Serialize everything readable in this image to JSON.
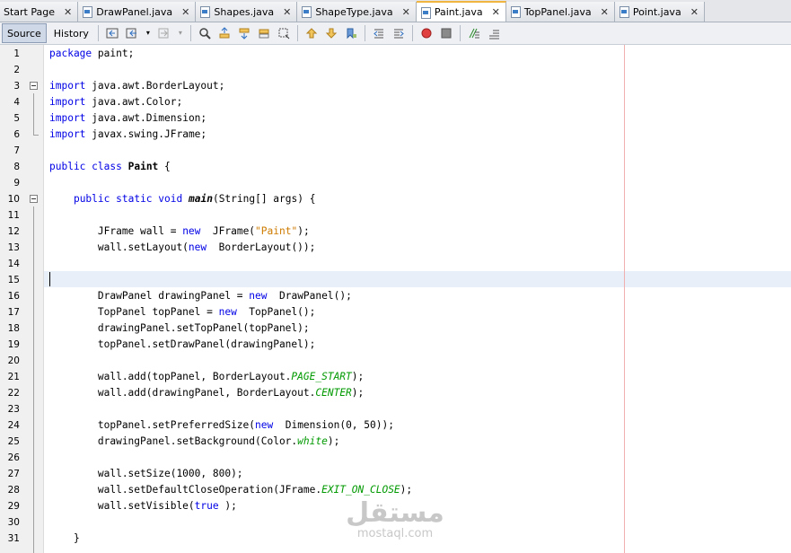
{
  "tabs": [
    {
      "label": "Start Page",
      "active": false,
      "icon": "none"
    },
    {
      "label": "DrawPanel.java",
      "active": false,
      "icon": "java-file-icon"
    },
    {
      "label": "Shapes.java",
      "active": false,
      "icon": "java-file-icon"
    },
    {
      "label": "ShapeType.java",
      "active": false,
      "icon": "java-file-icon"
    },
    {
      "label": "Paint.java",
      "active": true,
      "icon": "java-file-icon"
    },
    {
      "label": "TopPanel.java",
      "active": false,
      "icon": "java-file-icon"
    },
    {
      "label": "Point.java",
      "active": false,
      "icon": "java-file-icon"
    }
  ],
  "close_glyph": "✕",
  "toolbar": {
    "source_label": "Source",
    "history_label": "History"
  },
  "lines": [
    {
      "n": "1",
      "tokens": [
        [
          "kw",
          "package"
        ],
        [
          "",
          "paint;"
        ]
      ]
    },
    {
      "n": "2",
      "tokens": []
    },
    {
      "n": "3",
      "tokens": [
        [
          "kw",
          "import"
        ],
        [
          "",
          "java.awt.BorderLayout;"
        ]
      ]
    },
    {
      "n": "4",
      "tokens": [
        [
          "kw",
          "import"
        ],
        [
          "",
          "java.awt.Color;"
        ]
      ]
    },
    {
      "n": "5",
      "tokens": [
        [
          "kw",
          "import"
        ],
        [
          "",
          "java.awt.Dimension;"
        ]
      ]
    },
    {
      "n": "6",
      "tokens": [
        [
          "kw",
          "import"
        ],
        [
          "",
          "javax.swing.JFrame;"
        ]
      ]
    },
    {
      "n": "7",
      "tokens": []
    },
    {
      "n": "8",
      "tokens": [
        [
          "kw",
          "public"
        ],
        [
          "",
          ""
        ],
        [
          "kw",
          "class"
        ],
        [
          "",
          ""
        ],
        [
          "bold",
          "Paint"
        ],
        [
          "",
          " {"
        ]
      ]
    },
    {
      "n": "9",
      "tokens": []
    },
    {
      "n": "10",
      "tokens": [
        [
          "",
          "    "
        ],
        [
          "kw",
          "public"
        ],
        [
          "",
          ""
        ],
        [
          "kw",
          "static"
        ],
        [
          "",
          ""
        ],
        [
          "kw",
          "void"
        ],
        [
          "",
          ""
        ],
        [
          "bolditalic",
          "main"
        ],
        [
          "",
          "(String[] args) {"
        ]
      ]
    },
    {
      "n": "11",
      "tokens": []
    },
    {
      "n": "12",
      "tokens": [
        [
          "",
          "        JFrame wall = "
        ],
        [
          "kw",
          "new"
        ],
        [
          "",
          " JFrame("
        ],
        [
          "str",
          "\"Paint\""
        ],
        [
          "",
          ");"
        ]
      ]
    },
    {
      "n": "13",
      "tokens": [
        [
          "",
          "        wall.setLayout("
        ],
        [
          "kw",
          "new"
        ],
        [
          "",
          " BorderLayout());"
        ]
      ]
    },
    {
      "n": "14",
      "tokens": []
    },
    {
      "n": "15",
      "tokens": []
    },
    {
      "n": "16",
      "tokens": [
        [
          "",
          "        DrawPanel drawingPanel = "
        ],
        [
          "kw",
          "new"
        ],
        [
          "",
          " DrawPanel();"
        ]
      ]
    },
    {
      "n": "17",
      "tokens": [
        [
          "",
          "        TopPanel topPanel = "
        ],
        [
          "kw",
          "new"
        ],
        [
          "",
          " TopPanel();"
        ]
      ]
    },
    {
      "n": "18",
      "tokens": [
        [
          "",
          "        drawingPanel.setTopPanel(topPanel);"
        ]
      ]
    },
    {
      "n": "19",
      "tokens": [
        [
          "",
          "        topPanel.setDrawPanel(drawingPanel);"
        ]
      ]
    },
    {
      "n": "20",
      "tokens": []
    },
    {
      "n": "21",
      "tokens": [
        [
          "",
          "        wall.add(topPanel, BorderLayout."
        ],
        [
          "it",
          "PAGE_START"
        ],
        [
          "",
          ");"
        ]
      ]
    },
    {
      "n": "22",
      "tokens": [
        [
          "",
          "        wall.add(drawingPanel, BorderLayout."
        ],
        [
          "it",
          "CENTER"
        ],
        [
          "",
          ");"
        ]
      ]
    },
    {
      "n": "23",
      "tokens": []
    },
    {
      "n": "24",
      "tokens": [
        [
          "",
          "        topPanel.setPreferredSize("
        ],
        [
          "kw",
          "new"
        ],
        [
          "",
          " Dimension(0, 50));"
        ]
      ]
    },
    {
      "n": "25",
      "tokens": [
        [
          "",
          "        drawingPanel.setBackground(Color."
        ],
        [
          "it",
          "white"
        ],
        [
          "",
          ");"
        ]
      ]
    },
    {
      "n": "26",
      "tokens": []
    },
    {
      "n": "27",
      "tokens": [
        [
          "",
          "        wall.setSize(1000, 800);"
        ]
      ]
    },
    {
      "n": "28",
      "tokens": [
        [
          "",
          "        wall.setDefaultCloseOperation(JFrame."
        ],
        [
          "it",
          "EXIT_ON_CLOSE"
        ],
        [
          "",
          ");"
        ]
      ]
    },
    {
      "n": "29",
      "tokens": [
        [
          "",
          "        wall.setVisible("
        ],
        [
          "kw",
          "true"
        ],
        [
          "",
          ");"
        ]
      ]
    },
    {
      "n": "30",
      "tokens": []
    },
    {
      "n": "31",
      "tokens": [
        [
          "",
          "    }"
        ]
      ]
    }
  ],
  "watermark": {
    "arabic": "مستقل",
    "latin": "mostaql.com"
  },
  "colors": {
    "keyword": "#0000e6",
    "string": "#ce7b00",
    "constant": "#009900",
    "active_tab_accent": "#f0b540"
  }
}
